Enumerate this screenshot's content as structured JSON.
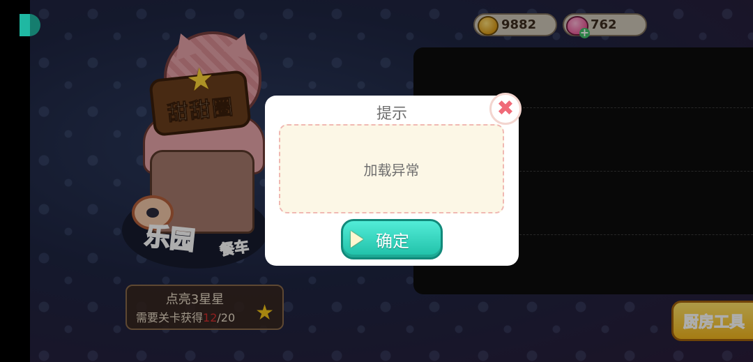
{
  "currency": {
    "coins": "9882",
    "gems": "762",
    "coin_icon": "coin-icon",
    "gem_icon": "gem-icon"
  },
  "restaurant": {
    "sign": "甜甜圈",
    "title": "乐园",
    "subtitle": "餐车"
  },
  "stars": {
    "title": "点亮3星星",
    "requirement_prefix": "需要关卡获得",
    "current": "12",
    "total": "/20"
  },
  "kitchen_button": "厨房工具",
  "dialog": {
    "title": "提示",
    "message": "加载异常",
    "confirm_label": "确定"
  },
  "colors": {
    "confirm_button": "#2fd6bd",
    "close_button": "#f06a78",
    "progress_current": "#d62f2f"
  }
}
